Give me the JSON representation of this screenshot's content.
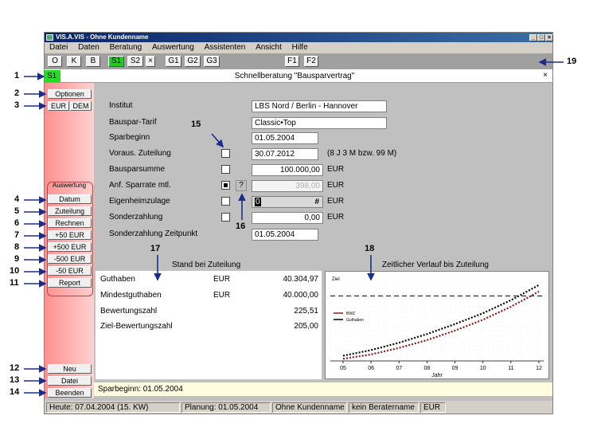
{
  "window": {
    "title": "VIS.A.VIS - Ohne Kundenname"
  },
  "menu": [
    "Datei",
    "Daten",
    "Beratung",
    "Auswertung",
    "Assistenten",
    "Ansicht",
    "Hilfe"
  ],
  "toolbar": {
    "buttons": [
      "O",
      "K",
      "B",
      "S1",
      "S2",
      "×",
      "G1",
      "G2",
      "G3",
      "F1",
      "F2"
    ],
    "active": "S1"
  },
  "tab": {
    "label": "S1",
    "title": "Schnellberatung \"Bausparvertrag\"",
    "close": "×"
  },
  "sidebar": {
    "optionen": "Optionen",
    "currency": [
      "EUR",
      "DEM"
    ],
    "group_label": "Auswertung",
    "buttons": [
      "Datum",
      "Zuteilung",
      "Rechnen",
      "+50 EUR",
      "+500 EUR",
      "-500 EUR",
      "-50 EUR",
      "Report"
    ],
    "bottom_buttons": [
      "Neu",
      "Datei",
      "Beenden"
    ]
  },
  "form": {
    "institut": {
      "label": "Institut",
      "value": "LBS Nord / Berlin - Hannover"
    },
    "tarif": {
      "label": "Bauspar-Tarif",
      "value": "Classic•Top"
    },
    "sparbeginn": {
      "label": "Sparbeginn",
      "value": "01.05.2004"
    },
    "zuteilung": {
      "label": "Voraus. Zuteilung",
      "value": "30.07.2012",
      "note": "(8 J 3 M bzw. 99 M)"
    },
    "bausparsumme": {
      "label": "Bausparsumme",
      "value": "100.000,00",
      "unit": "EUR"
    },
    "sparrate": {
      "label": "Anf. Sparrate mtl.",
      "value": "398,00",
      "unit": "EUR",
      "hint": "?"
    },
    "eigenheimzulage": {
      "label": "Eigenheimzulage",
      "value": "0",
      "marker": "#",
      "unit": "EUR"
    },
    "sonderzahlung": {
      "label": "Sonderzahlung",
      "value": "0,00",
      "unit": "EUR"
    },
    "sonderzahlung_zeitpunkt": {
      "label": "Sonderzahlung Zeitpunkt",
      "value": "01.05.2004"
    }
  },
  "results": {
    "heading": "Stand bei Zuteilung",
    "rows": [
      {
        "label": "Guthaben",
        "unit": "EUR",
        "value": "40.304,97"
      },
      {
        "label": "Mindestguthaben",
        "unit": "EUR",
        "value": "40.000,00"
      },
      {
        "label": "Bewertungszahl",
        "unit": "",
        "value": "225,51"
      },
      {
        "label": "Ziel-Bewertungszahl",
        "unit": "",
        "value": "205,00"
      }
    ]
  },
  "chart_heading": "Zeitlicher Verlauf bis Zuteilung",
  "chart_data": {
    "type": "line",
    "x": [
      "05",
      "06",
      "07",
      "08",
      "09",
      "10",
      "11",
      "12"
    ],
    "xlabel": "Jahr",
    "ziel_label": "Ziel",
    "series": [
      {
        "name": "BWZ",
        "color": "#8b1a1a",
        "values": [
          5,
          15,
          30,
          48,
          70,
          95,
          125,
          160
        ]
      },
      {
        "name": "Guthaben",
        "color": "#000000",
        "values": [
          12,
          25,
          42,
          62,
          85,
          110,
          140,
          175
        ]
      }
    ],
    "ziel_value": 150,
    "ylim": [
      0,
      180
    ]
  },
  "statusline": "Sparbeginn: 01.05.2004",
  "statusbar": [
    "Heute: 07.04.2004 (15. KW)",
    "Planung: 01.05.2004",
    "Ohne Kundenname",
    "kein Beratername",
    "EUR"
  ],
  "callouts": [
    "1",
    "2",
    "3",
    "4",
    "5",
    "6",
    "7",
    "8",
    "9",
    "10",
    "11",
    "12",
    "13",
    "14",
    "15",
    "16",
    "17",
    "18",
    "19"
  ],
  "colors": {
    "accent_green": "#22cc22",
    "sidebar_red": "#ff8f8f",
    "callout_blue": "#1a2d8f"
  }
}
